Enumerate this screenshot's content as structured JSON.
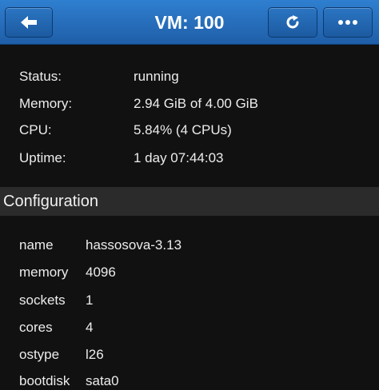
{
  "header": {
    "title": "VM: 100",
    "back_icon": "arrow-left-icon",
    "refresh_icon": "refresh-icon",
    "more_icon": "more-dots-icon"
  },
  "status": {
    "rows": [
      {
        "label": "Status:",
        "value": "running"
      },
      {
        "label": "Memory:",
        "value": "2.94 GiB of 4.00 GiB"
      },
      {
        "label": "CPU:",
        "value": "5.84% (4 CPUs)"
      },
      {
        "label": "Uptime:",
        "value": "1 day 07:44:03"
      }
    ]
  },
  "configuration": {
    "heading": "Configuration",
    "rows": [
      {
        "label": "name",
        "value": "hassosova-3.13"
      },
      {
        "label": "memory",
        "value": "4096"
      },
      {
        "label": "sockets",
        "value": "1"
      },
      {
        "label": "cores",
        "value": "4"
      },
      {
        "label": "ostype",
        "value": "l26"
      },
      {
        "label": "bootdisk",
        "value": "sata0"
      }
    ]
  },
  "colors": {
    "header_blue": "#2a6fbd",
    "background": "#111111",
    "section_bg": "#2b2b2b",
    "text": "#ececec"
  }
}
